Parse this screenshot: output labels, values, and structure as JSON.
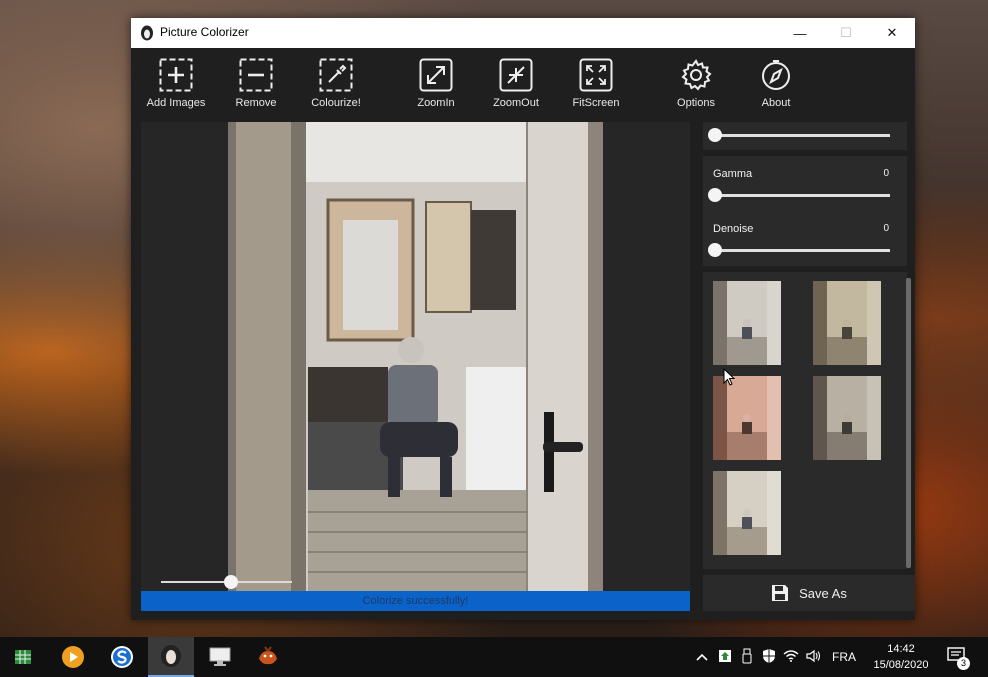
{
  "window": {
    "title": "Picture Colorizer",
    "minimize": "—",
    "maximize": "☐",
    "close": "✕"
  },
  "toolbar": {
    "add_images": "Add Images",
    "remove": "Remove",
    "colourize": "Colourize!",
    "zoom_in": "ZoomIn",
    "zoom_out": "ZoomOut",
    "fit_screen": "FitScreen",
    "options": "Options",
    "about": "About"
  },
  "adjustments": {
    "gamma": {
      "label": "Gamma",
      "value": "0"
    },
    "denoise": {
      "label": "Denoise",
      "value": "0"
    }
  },
  "status": {
    "message": "Colorize successfully!"
  },
  "save": {
    "label": "Save As"
  },
  "taskbar": {
    "language": "FRA",
    "time": "14:42",
    "date": "15/08/2020",
    "notifications": "3"
  },
  "colors": {
    "accent": "#0b63c9",
    "window_bg": "#1f1f1f",
    "panel_bg": "#2a2a2a"
  }
}
